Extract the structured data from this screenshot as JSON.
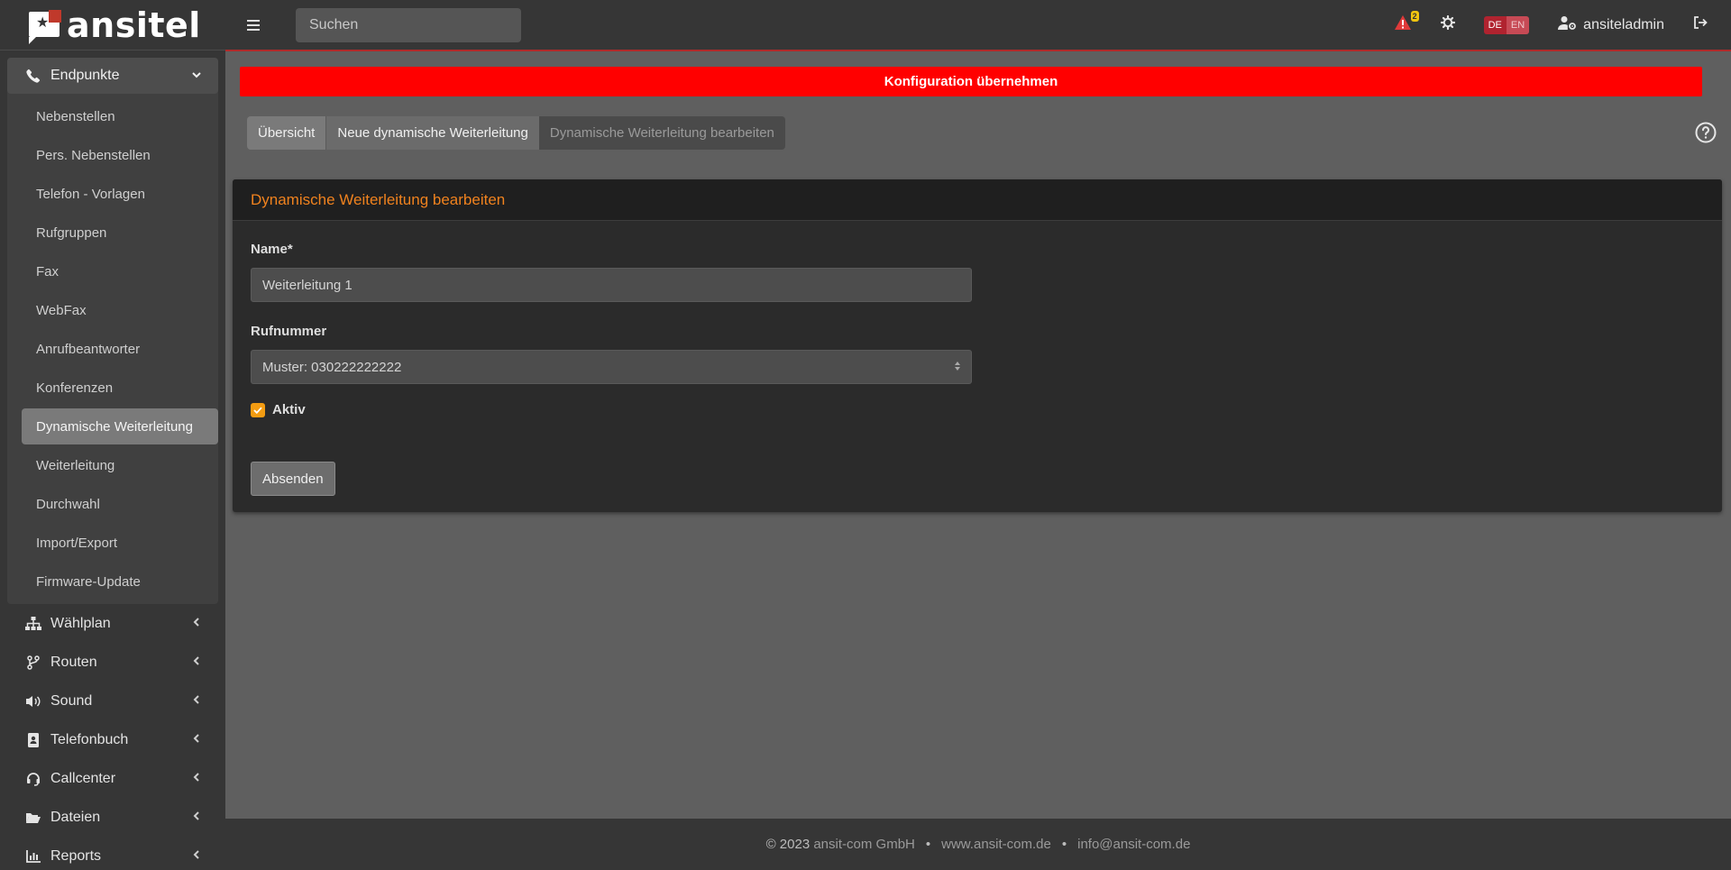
{
  "brand": {
    "name": "ansitel"
  },
  "topbar": {
    "search_placeholder": "Suchen",
    "alert_count": "2",
    "lang_de": "DE",
    "lang_en": "EN",
    "username": "ansiteladmin"
  },
  "sidebar": {
    "open_section": {
      "label": "Endpunkte",
      "icon": "phone-icon"
    },
    "sub_items": [
      "Nebenstellen",
      "Pers. Nebenstellen",
      "Telefon - Vorlagen",
      "Rufgruppen",
      "Fax",
      "WebFax",
      "Anrufbeantworter",
      "Konferenzen",
      "Dynamische Weiterleitung",
      "Weiterleitung",
      "Durchwahl",
      "Import/Export",
      "Firmware-Update"
    ],
    "active_sub_item": "Dynamische Weiterleitung",
    "sections": [
      {
        "label": "Wählplan",
        "icon": "sitemap-icon"
      },
      {
        "label": "Routen",
        "icon": "route-icon"
      },
      {
        "label": "Sound",
        "icon": "volume-icon"
      },
      {
        "label": "Telefonbuch",
        "icon": "address-book-icon"
      },
      {
        "label": "Callcenter",
        "icon": "headset-icon"
      },
      {
        "label": "Dateien",
        "icon": "folder-open-icon"
      },
      {
        "label": "Reports",
        "icon": "chart-icon"
      }
    ]
  },
  "main": {
    "apply_label": "Konfiguration übernehmen",
    "tabs": [
      {
        "label": "Übersicht"
      },
      {
        "label": "Neue dynamische Weiterleitung"
      },
      {
        "label": "Dynamische Weiterleitung bearbeiten"
      }
    ],
    "card_title": "Dynamische Weiterleitung bearbeiten",
    "form": {
      "name_label": "Name*",
      "name_value": "Weiterleitung 1",
      "number_label": "Rufnummer",
      "number_value": "Muster: 030222222222",
      "active_label": "Aktiv",
      "active_checked": true,
      "submit_label": "Absenden"
    }
  },
  "footer": {
    "copyright": "© 2023",
    "company": "ansit-com GmbH",
    "website": "www.ansit-com.de",
    "email": "info@ansit-com.de",
    "separator": "•"
  },
  "colors": {
    "accent_orange": "#f0821e",
    "apply_red": "#ff0000",
    "checkbox": "#f39c12"
  }
}
